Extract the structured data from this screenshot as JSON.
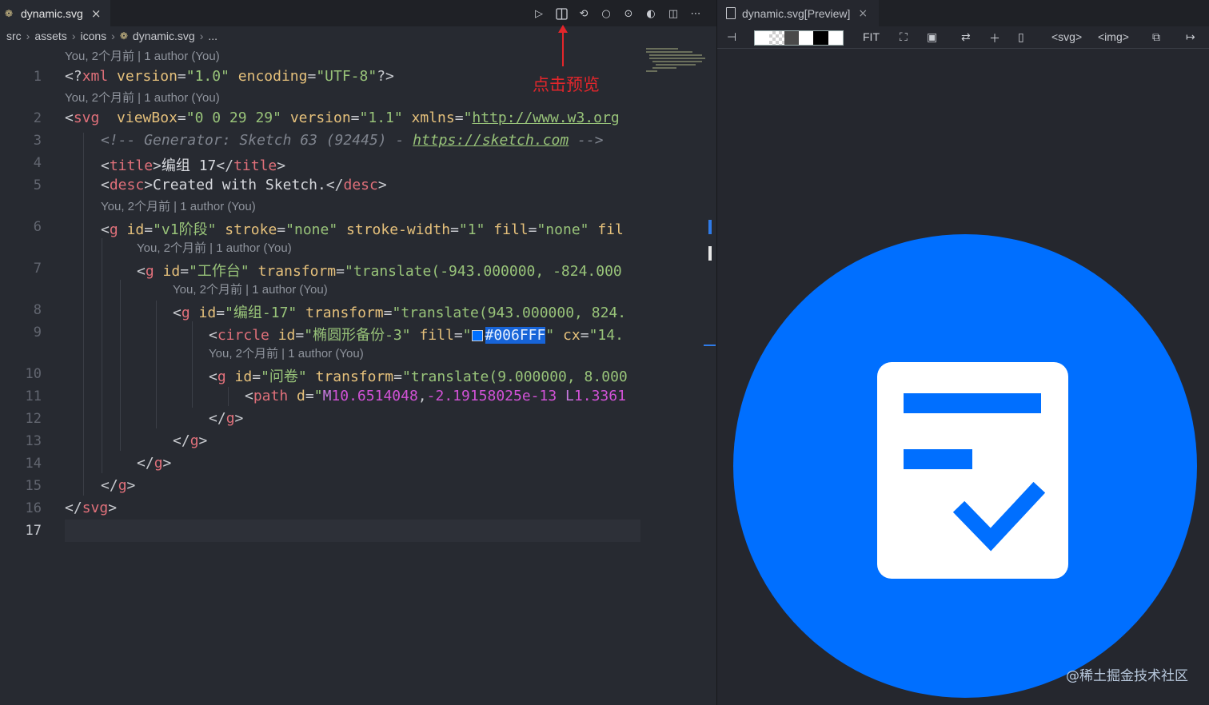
{
  "editor": {
    "tab": {
      "label": "dynamic.svg",
      "close": "×"
    },
    "breadcrumb": [
      "src",
      "assets",
      "icons",
      "dynamic.svg",
      "..."
    ],
    "annotation": "点击预览",
    "blame": "You, 2个月前 | 1 author (You)",
    "code": {
      "l1": {
        "num": "1"
      },
      "l2": {
        "num": "2"
      },
      "l3": {
        "num": "3",
        "comment": "<!-- Generator: Sketch 63 (92445) - ",
        "url": "https://sketch.com",
        "end": " -->"
      },
      "l4": {
        "num": "4",
        "text": "编组 17"
      },
      "l5": {
        "num": "5",
        "text": "Created with Sketch."
      },
      "l6": {
        "num": "6"
      },
      "l7": {
        "num": "7"
      },
      "l8": {
        "num": "8"
      },
      "l9": {
        "num": "9",
        "color": "#006FFF"
      },
      "l10": {
        "num": "10"
      },
      "l11": {
        "num": "11"
      },
      "l12": {
        "num": "12"
      },
      "l13": {
        "num": "13"
      },
      "l14": {
        "num": "14"
      },
      "l15": {
        "num": "15"
      },
      "l16": {
        "num": "16"
      },
      "l17": {
        "num": "17"
      }
    }
  },
  "preview": {
    "tab": {
      "label": "dynamic.svg[Preview]",
      "close": "×"
    },
    "tools": {
      "fit": "FIT",
      "svg": "<svg>",
      "img": "<img>"
    },
    "icon_fill": "#006FFF",
    "watermark": "@稀土掘金技术社区"
  }
}
